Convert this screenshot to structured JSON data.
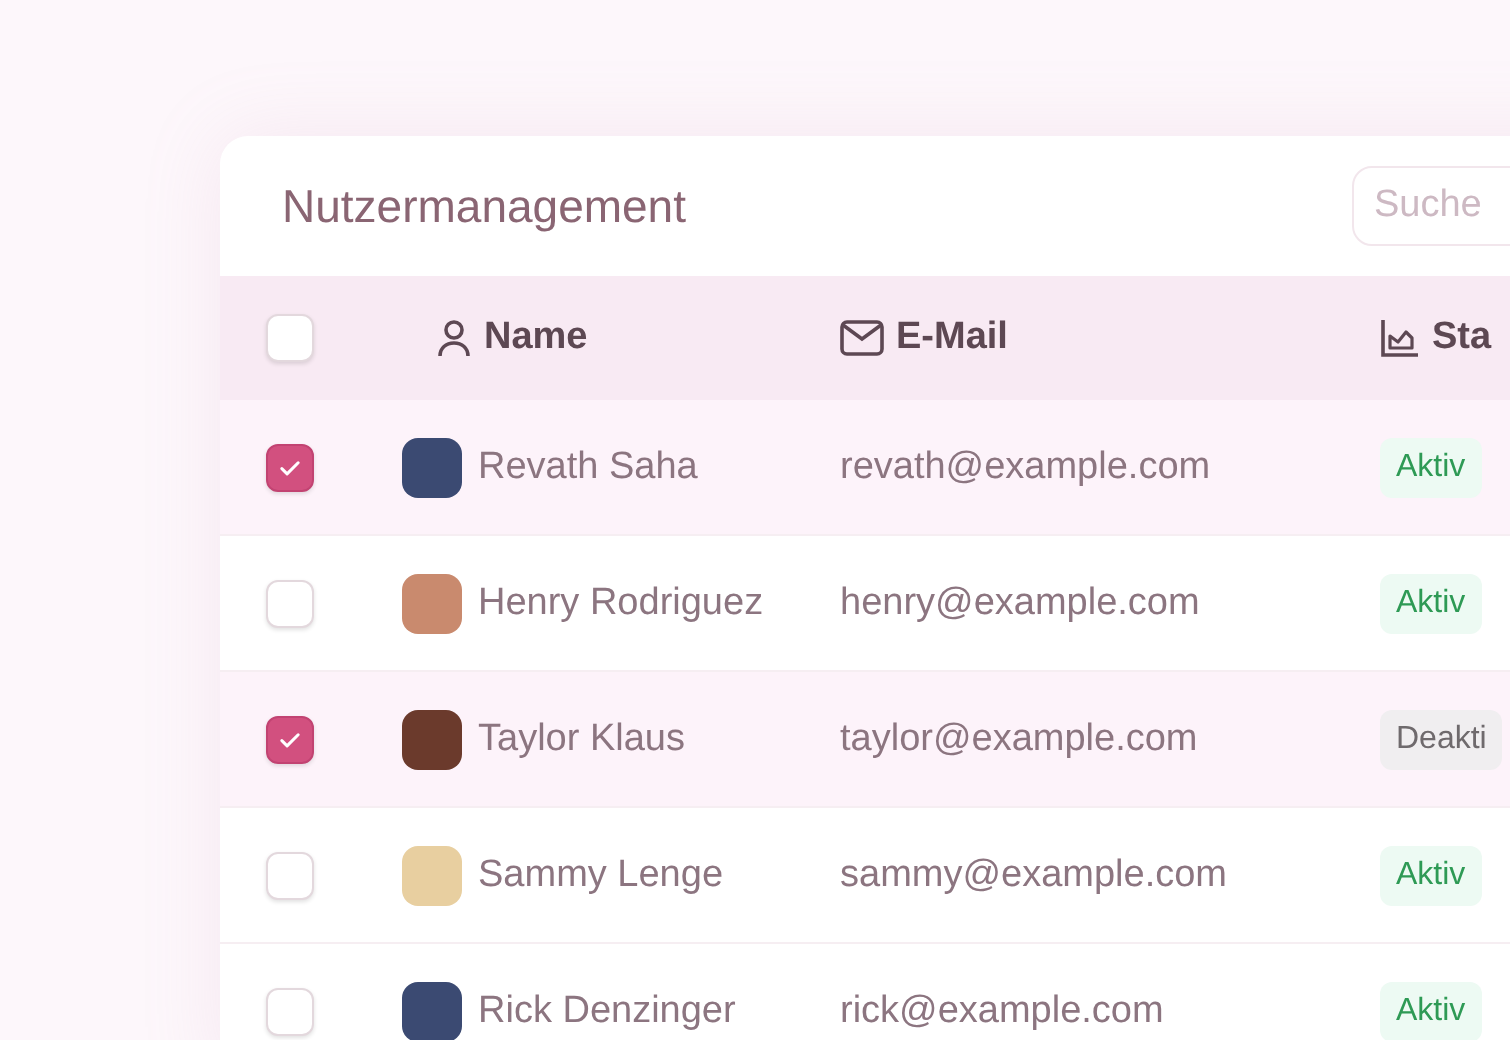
{
  "title": "Nutzermanagement",
  "search": {
    "placeholder": "Suche"
  },
  "columns": [
    {
      "kind": "checkbox",
      "checked": false
    },
    {
      "kind": "name",
      "label": "Name"
    },
    {
      "kind": "email",
      "label": "E-Mail"
    },
    {
      "kind": "status",
      "label": "Sta"
    }
  ],
  "rows": [
    {
      "selected": true,
      "name": "Revath Saha",
      "email": "revath@example.com",
      "status": {
        "kind": "active",
        "label": "Aktiv"
      }
    },
    {
      "selected": false,
      "name": "Henry Rodriguez",
      "email": "henry@example.com",
      "status": {
        "kind": "active",
        "label": "Aktiv"
      }
    },
    {
      "selected": true,
      "name": "Taylor Klaus",
      "email": "taylor@example.com",
      "status": {
        "kind": "inactive",
        "label": "Deakti"
      }
    },
    {
      "selected": false,
      "name": "Sammy Lenge",
      "email": "sammy@example.com",
      "status": {
        "kind": "active",
        "label": "Aktiv"
      }
    },
    {
      "selected": false,
      "name": "Rick Denzinger",
      "email": "rick@example.com",
      "status": {
        "kind": "active",
        "label": "Aktiv"
      }
    }
  ]
}
